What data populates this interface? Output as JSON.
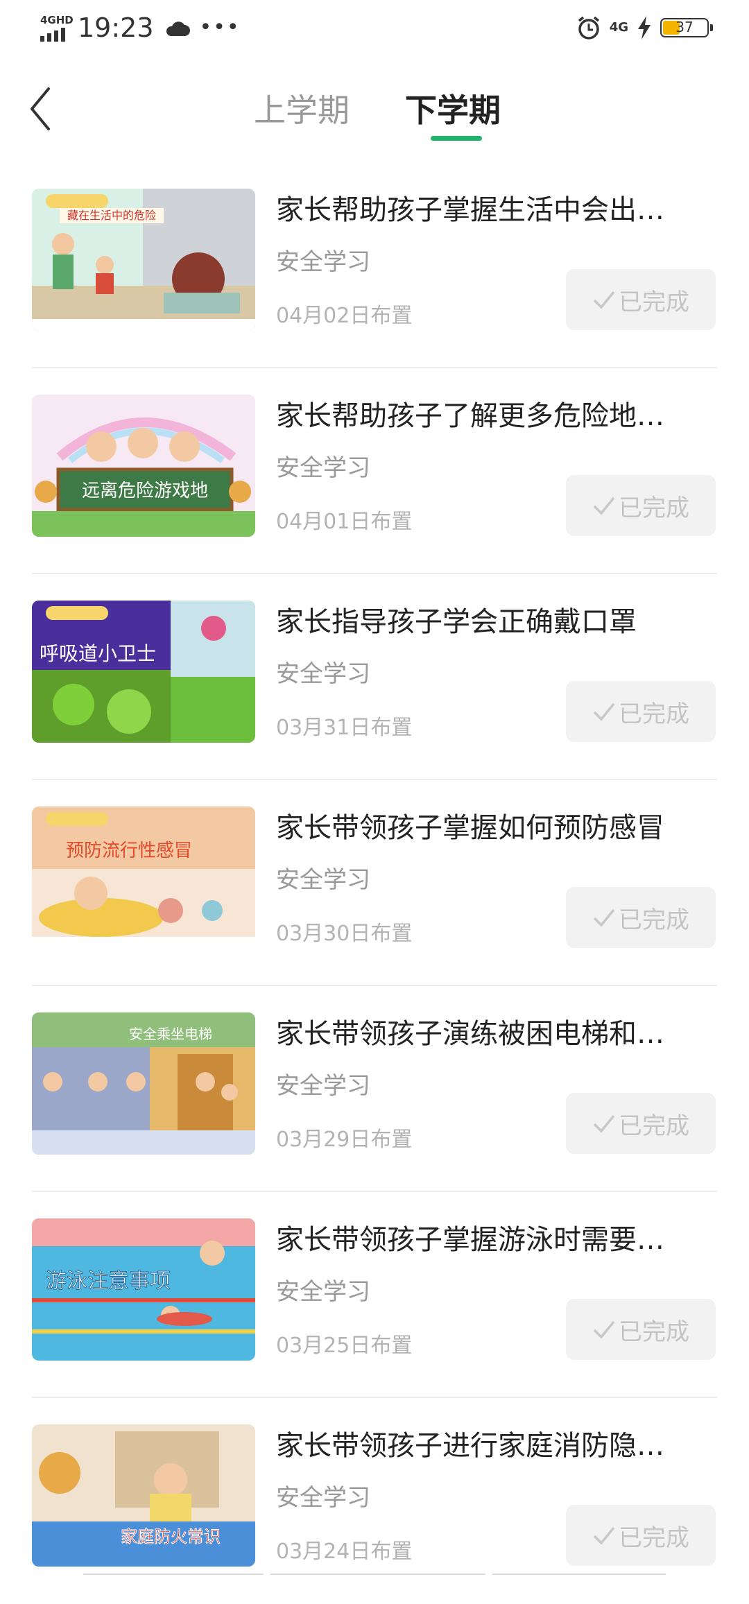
{
  "status_bar": {
    "network": "4GHD",
    "time": "19:23",
    "net_right": "4G",
    "battery": "37"
  },
  "header": {
    "tabs": [
      {
        "label": "上学期",
        "active": false
      },
      {
        "label": "下学期",
        "active": true
      }
    ],
    "accent_color": "#1fb46a"
  },
  "items": [
    {
      "title": "家长帮助孩子掌握生活中会出…",
      "category": "安全学习",
      "date": "04月02日布置",
      "status": "已完成",
      "thumb_text": "藏在生活中的危险"
    },
    {
      "title": "家长帮助孩子了解更多危险地…",
      "category": "安全学习",
      "date": "04月01日布置",
      "status": "已完成",
      "thumb_text": "远离危险游戏地"
    },
    {
      "title": "家长指导孩子学会正确戴口罩",
      "category": "安全学习",
      "date": "03月31日布置",
      "status": "已完成",
      "thumb_text": "呼吸道小卫士"
    },
    {
      "title": "家长带领孩子掌握如何预防感冒",
      "category": "安全学习",
      "date": "03月30日布置",
      "status": "已完成",
      "thumb_text": "预防流行性感冒"
    },
    {
      "title": "家长带领孩子演练被困电梯和…",
      "category": "安全学习",
      "date": "03月29日布置",
      "status": "已完成",
      "thumb_text": "安全乘坐电梯"
    },
    {
      "title": "家长带领孩子掌握游泳时需要…",
      "category": "安全学习",
      "date": "03月25日布置",
      "status": "已完成",
      "thumb_text": "游泳注意事项"
    },
    {
      "title": "家长带领孩子进行家庭消防隐…",
      "category": "安全学习",
      "date": "03月24日布置",
      "status": "已完成",
      "thumb_text": "家庭防火常识"
    }
  ]
}
